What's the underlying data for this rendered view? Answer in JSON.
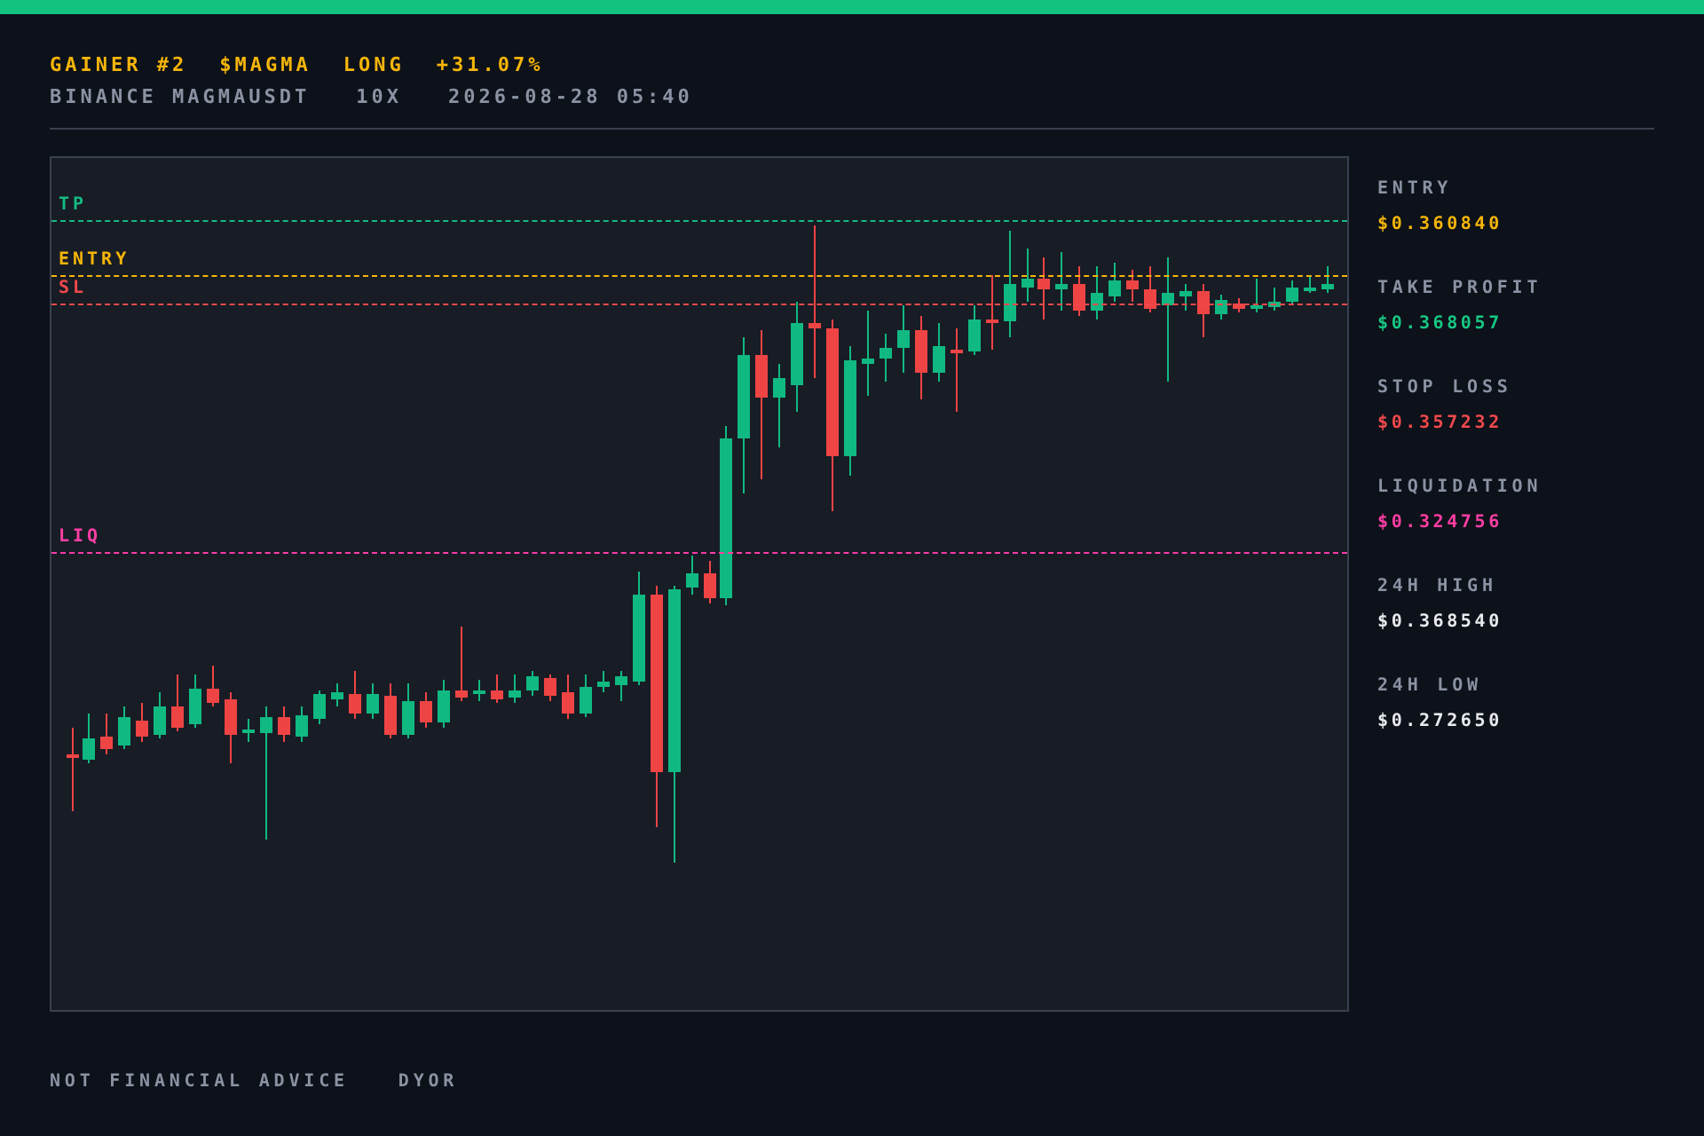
{
  "header": {
    "title_parts": [
      {
        "text": "GAINER #2",
        "color": "#f5b50a"
      },
      {
        "text": "$MAGMA",
        "color": "#f5b50a"
      },
      {
        "text": "LONG",
        "color": "#f5b50a"
      },
      {
        "text": "+31.07%",
        "color": "#f5b50a"
      }
    ],
    "subtitle_parts": [
      "BINANCE MAGMAUSDT",
      "10X",
      "2026-08-28 05:40"
    ]
  },
  "chart": {
    "level_lines": [
      {
        "label": "TP",
        "color": "#16b981"
      },
      {
        "label": "ENTRY",
        "color": "#f5b50a"
      },
      {
        "label": "SL",
        "color": "#f0494c"
      },
      {
        "label": "LIQ",
        "color": "#ff3ea5"
      }
    ]
  },
  "stats": [
    {
      "label": "ENTRY",
      "value": "$0.360840",
      "color": "#f5b50a"
    },
    {
      "label": "TAKE PROFIT",
      "value": "$0.368057",
      "color": "#16c784"
    },
    {
      "label": "STOP LOSS",
      "value": "$0.357232",
      "color": "#f0494c"
    },
    {
      "label": "LIQUIDATION",
      "value": "$0.324756",
      "color": "#ff3ea5"
    },
    {
      "label": "24H HIGH",
      "value": "$0.368540",
      "color": "#e8eaee"
    },
    {
      "label": "24H LOW",
      "value": "$0.272650",
      "color": "#e8eaee"
    }
  ],
  "footer": [
    "NOT FINANCIAL ADVICE",
    "DYOR"
  ]
}
